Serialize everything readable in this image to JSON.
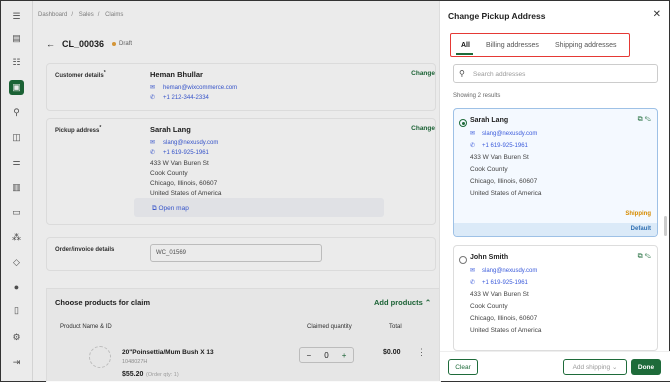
{
  "breadcrumb": [
    "Dashboard",
    "Sales",
    "Claims"
  ],
  "claim": {
    "id": "CL_00036",
    "status": "Draft"
  },
  "customer": {
    "label": "Customer details",
    "name": "Heman Bhullar",
    "email": "heman@wixcommerce.com",
    "phone": "+1 212-344-2334",
    "change": "Change"
  },
  "pickup": {
    "label": "Pickup address",
    "name": "Sarah Lang",
    "email": "slang@nexusdy.com",
    "phone": "+1 619-925-1961",
    "lines": [
      "433 W Van Buren St",
      "Cook County",
      "Chicago, Illinois, 60607",
      "United States of America"
    ],
    "change": "Change",
    "open_map": "Open map"
  },
  "order": {
    "label": "Order/invoice details",
    "value": "WC_01569"
  },
  "products": {
    "title": "Choose products for claim",
    "add": "Add products",
    "headers": {
      "name": "Product Name & ID",
      "qty": "Claimed quantity",
      "total": "Total"
    },
    "item": {
      "name": "20\"Poinsettia/Mum Bush X 13",
      "sku": "1048027H",
      "price": "$55.20",
      "note": "(Order qty: 1)",
      "qty": "0",
      "total": "$0.00"
    }
  },
  "panel": {
    "title": "Change Pickup Address",
    "tabs": [
      "All",
      "Billing addresses",
      "Shipping addresses"
    ],
    "search_placeholder": "Search addresses",
    "results": "Showing 2 results",
    "cards": [
      {
        "name": "Sarah Lang",
        "email": "slang@nexusdy.com",
        "phone": "+1 619-925-1961",
        "lines": [
          "433 W Van Buren St",
          "Cook County",
          "Chicago, Illinois, 60607",
          "United States of America"
        ],
        "tag": "Shipping",
        "footer": "Default"
      },
      {
        "name": "John Smith",
        "email": "slang@nexusdy.com",
        "phone": "+1 619-925-1961",
        "lines": [
          "433 W Van Buren St",
          "Cook County",
          "Chicago, Illinois, 60607",
          "United States of America"
        ]
      }
    ],
    "buttons": {
      "clear": "Clear",
      "add_shipping": "Add shipping",
      "done": "Done"
    }
  },
  "colors": {
    "brand": "#1e6b3a",
    "link": "#3b5bdb",
    "highlight": "#e53935",
    "shipping": "#d68b00"
  }
}
